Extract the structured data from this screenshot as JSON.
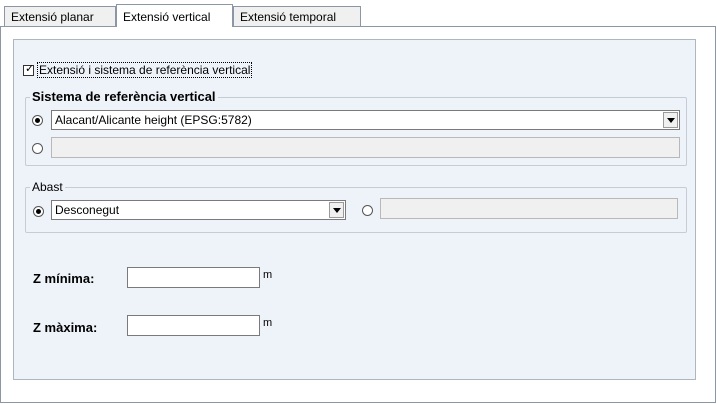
{
  "tabs": [
    {
      "label": "Extensió planar"
    },
    {
      "label": "Extensió vertical"
    },
    {
      "label": "Extensió temporal"
    }
  ],
  "vertical_extent": {
    "checkbox_label": "Extensió i sistema de referència vertical",
    "checked": true
  },
  "reference_system": {
    "title": "Sistema de referència vertical",
    "selected_value": "Alacant/Alicante height (EPSG:5782)",
    "custom_value": ""
  },
  "scope": {
    "title": "Abast",
    "selected_value": "Desconegut",
    "custom_value": ""
  },
  "z_min": {
    "label": "Z mínima:",
    "value": "",
    "unit": "m"
  },
  "z_max": {
    "label": "Z màxima:",
    "value": "",
    "unit": "m"
  }
}
